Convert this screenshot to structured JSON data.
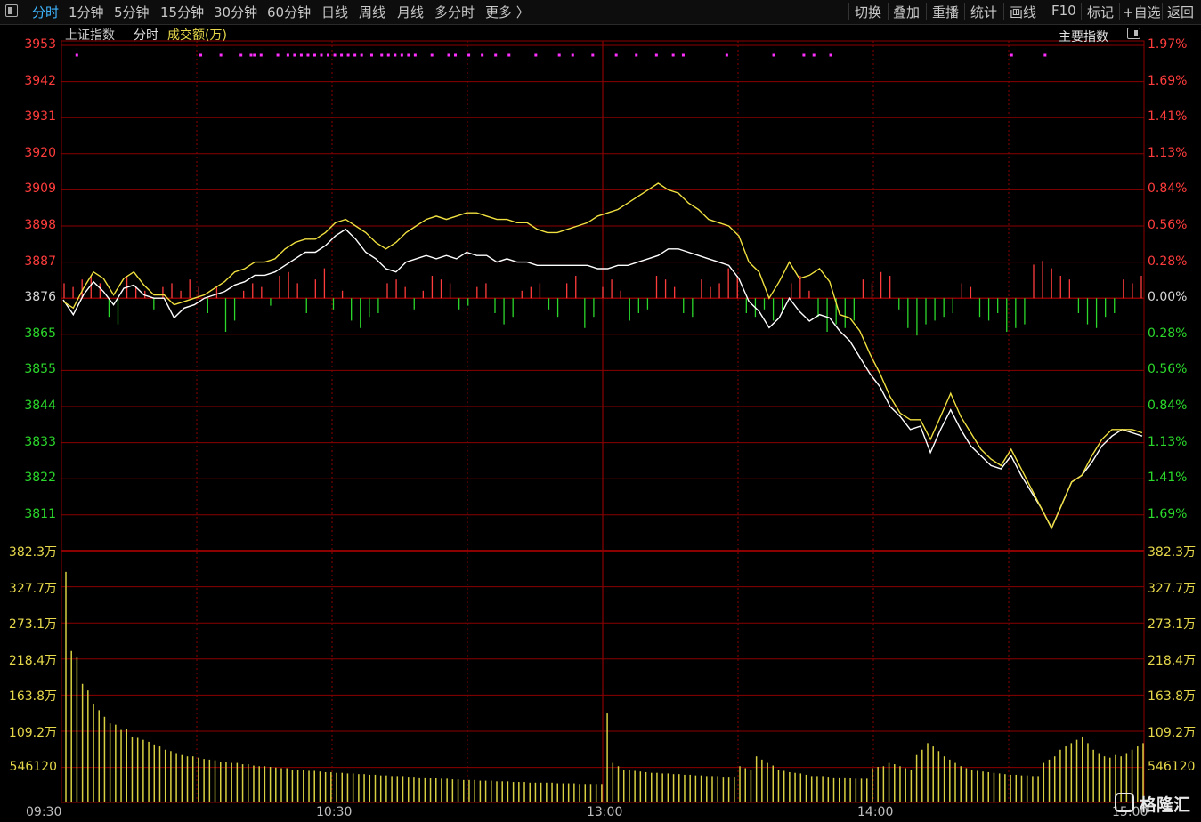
{
  "toolbar": {
    "tabs": [
      "分时",
      "1分钟",
      "5分钟",
      "15分钟",
      "30分钟",
      "60分钟",
      "日线",
      "周线",
      "月线",
      "多分时",
      "更多 〉"
    ],
    "active_tab": "分时",
    "actions": [
      "切换",
      "叠加",
      "重播",
      "统计",
      "画线",
      "F10",
      "标记",
      "+自选",
      "返回"
    ]
  },
  "subheader": {
    "index_name": "上证指数",
    "mode": "分时",
    "volume_label": "成交额(万)",
    "main_index_button": "主要指数"
  },
  "watermark": "格隆汇",
  "colors": {
    "up": "#ff3c3c",
    "down": "#2bd82b",
    "grid": "#8b0000",
    "price_line": "#ffffff",
    "avg_line": "#f0e040",
    "volume": "#d8d040",
    "signal": "#ff30ff"
  },
  "chart_data": {
    "type": "line",
    "price_axis": {
      "left_labels": [
        "3953",
        "3942",
        "3931",
        "3920",
        "3909",
        "3898",
        "3887",
        "3876",
        "3865",
        "3855",
        "3844",
        "3833",
        "3822",
        "3811"
      ],
      "right_labels": [
        "1.97%",
        "1.69%",
        "1.41%",
        "1.13%",
        "0.84%",
        "0.56%",
        "0.28%",
        "0.00%",
        "0.28%",
        "0.56%",
        "0.84%",
        "1.13%",
        "1.41%",
        "1.69%"
      ],
      "prev_close": 3876,
      "ylim": [
        3800.5,
        3953
      ]
    },
    "volume_axis": {
      "labels": [
        "382.3万",
        "327.7万",
        "273.1万",
        "218.4万",
        "163.8万",
        "109.2万",
        "546120"
      ],
      "ylim": [
        0,
        382.3
      ]
    },
    "time_labels": [
      "09:30",
      "10:30",
      "13:00",
      "14:00",
      "15:00"
    ],
    "minutes_total": 240,
    "series": [
      {
        "points": [
          [
            0,
            3875.5
          ],
          [
            3,
            3871
          ],
          [
            6,
            3877
          ],
          [
            9,
            3881
          ],
          [
            12,
            3878
          ],
          [
            15,
            3874
          ],
          [
            18,
            3879
          ],
          [
            21,
            3880
          ],
          [
            24,
            3877
          ],
          [
            27,
            3876
          ],
          [
            30,
            3876
          ],
          [
            33,
            3870
          ],
          [
            36,
            3873
          ],
          [
            39,
            3874
          ],
          [
            42,
            3876
          ],
          [
            45,
            3877
          ],
          [
            48,
            3878
          ],
          [
            51,
            3880
          ],
          [
            54,
            3881
          ],
          [
            57,
            3883
          ],
          [
            60,
            3883
          ],
          [
            63,
            3884
          ],
          [
            66,
            3886
          ],
          [
            69,
            3888
          ],
          [
            72,
            3890
          ],
          [
            75,
            3890
          ],
          [
            78,
            3892
          ],
          [
            81,
            3895
          ],
          [
            84,
            3897
          ],
          [
            87,
            3894
          ],
          [
            90,
            3890
          ],
          [
            93,
            3888
          ],
          [
            96,
            3885
          ],
          [
            99,
            3884
          ],
          [
            102,
            3887
          ],
          [
            105,
            3888
          ],
          [
            108,
            3889
          ],
          [
            111,
            3888
          ],
          [
            114,
            3889
          ],
          [
            117,
            3888
          ],
          [
            120,
            3890
          ],
          [
            123,
            3889
          ],
          [
            126,
            3889
          ],
          [
            129,
            3887
          ],
          [
            132,
            3888
          ],
          [
            135,
            3887
          ],
          [
            138,
            3887
          ],
          [
            141,
            3886
          ],
          [
            144,
            3886
          ],
          [
            147,
            3886
          ],
          [
            150,
            3886
          ],
          [
            153,
            3886
          ],
          [
            156,
            3886
          ],
          [
            159,
            3885
          ],
          [
            162,
            3885
          ],
          [
            165,
            3886
          ],
          [
            168,
            3886
          ],
          [
            171,
            3887
          ],
          [
            174,
            3888
          ],
          [
            177,
            3889
          ],
          [
            180,
            3891
          ],
          [
            183,
            3891
          ],
          [
            186,
            3890
          ],
          [
            189,
            3889
          ],
          [
            192,
            3888
          ],
          [
            195,
            3887
          ],
          [
            198,
            3886
          ],
          [
            201,
            3882
          ],
          [
            204,
            3875
          ],
          [
            207,
            3872
          ],
          [
            210,
            3867
          ],
          [
            213,
            3870
          ],
          [
            216,
            3876
          ],
          [
            219,
            3872
          ],
          [
            222,
            3869
          ],
          [
            225,
            3871
          ],
          [
            228,
            3870
          ],
          [
            231,
            3866
          ],
          [
            234,
            3863
          ],
          [
            237,
            3858
          ],
          [
            240,
            3853
          ],
          [
            243,
            3849
          ],
          [
            246,
            3843
          ],
          [
            249,
            3840
          ],
          [
            252,
            3836
          ],
          [
            255,
            3837
          ],
          [
            258,
            3829
          ],
          [
            261,
            3836
          ],
          [
            264,
            3842
          ],
          [
            267,
            3836
          ],
          [
            270,
            3831
          ],
          [
            273,
            3828
          ],
          [
            276,
            3825
          ],
          [
            279,
            3824
          ],
          [
            282,
            3828
          ],
          [
            285,
            3822
          ],
          [
            288,
            3817
          ],
          [
            291,
            3812
          ],
          [
            294,
            3806
          ],
          [
            297,
            3813
          ],
          [
            300,
            3820
          ],
          [
            303,
            3822
          ],
          [
            306,
            3826
          ],
          [
            309,
            3831
          ],
          [
            312,
            3834
          ],
          [
            315,
            3836
          ],
          [
            318,
            3835
          ],
          [
            321,
            3834
          ]
        ]
      },
      {
        "points": [
          [
            0,
            3875
          ],
          [
            3,
            3873
          ],
          [
            6,
            3879
          ],
          [
            9,
            3884
          ],
          [
            12,
            3882
          ],
          [
            15,
            3877
          ],
          [
            18,
            3882
          ],
          [
            21,
            3884
          ],
          [
            24,
            3880
          ],
          [
            27,
            3877
          ],
          [
            30,
            3877
          ],
          [
            33,
            3874
          ],
          [
            36,
            3875
          ],
          [
            39,
            3876
          ],
          [
            42,
            3877
          ],
          [
            45,
            3879
          ],
          [
            48,
            3881
          ],
          [
            51,
            3884
          ],
          [
            54,
            3885
          ],
          [
            57,
            3887
          ],
          [
            60,
            3887
          ],
          [
            63,
            3888
          ],
          [
            66,
            3891
          ],
          [
            69,
            3893
          ],
          [
            72,
            3894
          ],
          [
            75,
            3894
          ],
          [
            78,
            3896
          ],
          [
            81,
            3899
          ],
          [
            84,
            3900
          ],
          [
            87,
            3898
          ],
          [
            90,
            3896
          ],
          [
            93,
            3893
          ],
          [
            96,
            3891
          ],
          [
            99,
            3893
          ],
          [
            102,
            3896
          ],
          [
            105,
            3898
          ],
          [
            108,
            3900
          ],
          [
            111,
            3901
          ],
          [
            114,
            3900
          ],
          [
            117,
            3901
          ],
          [
            120,
            3902
          ],
          [
            123,
            3902
          ],
          [
            126,
            3901
          ],
          [
            129,
            3900
          ],
          [
            132,
            3900
          ],
          [
            135,
            3899
          ],
          [
            138,
            3899
          ],
          [
            141,
            3897
          ],
          [
            144,
            3896
          ],
          [
            147,
            3896
          ],
          [
            150,
            3897
          ],
          [
            153,
            3898
          ],
          [
            156,
            3899
          ],
          [
            159,
            3901
          ],
          [
            162,
            3902
          ],
          [
            165,
            3903
          ],
          [
            168,
            3905
          ],
          [
            171,
            3907
          ],
          [
            174,
            3909
          ],
          [
            177,
            3911
          ],
          [
            180,
            3909
          ],
          [
            183,
            3908
          ],
          [
            186,
            3905
          ],
          [
            189,
            3903
          ],
          [
            192,
            3900
          ],
          [
            195,
            3899
          ],
          [
            198,
            3898
          ],
          [
            201,
            3895
          ],
          [
            204,
            3887
          ],
          [
            207,
            3884
          ],
          [
            210,
            3876
          ],
          [
            213,
            3881
          ],
          [
            216,
            3887
          ],
          [
            219,
            3882
          ],
          [
            222,
            3883
          ],
          [
            225,
            3885
          ],
          [
            228,
            3881
          ],
          [
            231,
            3871
          ],
          [
            234,
            3870
          ],
          [
            237,
            3866
          ],
          [
            240,
            3859
          ],
          [
            243,
            3853
          ],
          [
            246,
            3846
          ],
          [
            249,
            3841
          ],
          [
            252,
            3839
          ],
          [
            255,
            3839
          ],
          [
            258,
            3833
          ],
          [
            261,
            3840
          ],
          [
            264,
            3847
          ],
          [
            267,
            3840
          ],
          [
            270,
            3835
          ],
          [
            273,
            3830
          ],
          [
            276,
            3827
          ],
          [
            279,
            3825
          ],
          [
            282,
            3830
          ],
          [
            285,
            3824
          ],
          [
            288,
            3818
          ],
          [
            291,
            3812
          ],
          [
            294,
            3806
          ],
          [
            297,
            3813
          ],
          [
            300,
            3820
          ],
          [
            303,
            3822
          ],
          [
            306,
            3828
          ],
          [
            309,
            3833
          ],
          [
            312,
            3836
          ],
          [
            315,
            3836
          ],
          [
            318,
            3836
          ],
          [
            321,
            3835
          ]
        ]
      }
    ],
    "change_bars": [
      4,
      3,
      5,
      6,
      4,
      -5,
      -7,
      6,
      3,
      2,
      -3,
      3,
      4,
      2,
      5,
      3,
      -4,
      3,
      -9,
      -6,
      2,
      4,
      3,
      -2,
      6,
      7,
      4,
      -4,
      5,
      8,
      -3,
      2,
      -6,
      -8,
      -5,
      -4,
      4,
      5,
      3,
      -3,
      2,
      6,
      5,
      4,
      -3,
      -2,
      3,
      4,
      -4,
      -7,
      -5,
      2,
      3,
      4,
      -3,
      -5,
      4,
      6,
      -8,
      -5,
      3,
      5,
      2,
      -6,
      -4,
      -3,
      6,
      5,
      3,
      -4,
      -5,
      5,
      3,
      4,
      8,
      6,
      -4,
      -5,
      -3,
      -6,
      -4,
      4,
      6,
      2,
      -5,
      -9,
      -7,
      -8,
      -6,
      5,
      4,
      7,
      6,
      -3,
      -8,
      -10,
      -7,
      -6,
      -5,
      -4,
      4,
      3,
      -5,
      -6,
      -4,
      -9,
      -8,
      -7,
      9,
      10,
      8,
      6,
      5,
      -4,
      -7,
      -8,
      -5,
      -4,
      5,
      4,
      6
    ],
    "volume": [
      350,
      230,
      220,
      180,
      170,
      150,
      140,
      130,
      120,
      118,
      110,
      112,
      100,
      98,
      95,
      92,
      88,
      85,
      80,
      78,
      75,
      72,
      70,
      70,
      68,
      66,
      65,
      64,
      62,
      62,
      60,
      60,
      58,
      58,
      56,
      55,
      55,
      54,
      53,
      52,
      52,
      50,
      50,
      49,
      48,
      48,
      47,
      46,
      46,
      45,
      45,
      44,
      44,
      43,
      43,
      42,
      42,
      41,
      41,
      40,
      40,
      40,
      39,
      39,
      38,
      38,
      37,
      37,
      36,
      36,
      35,
      35,
      34,
      34,
      34,
      33,
      33,
      33,
      32,
      32,
      32,
      31,
      31,
      31,
      30,
      30,
      30,
      30,
      30,
      29,
      29,
      29,
      29,
      28,
      28,
      28,
      28,
      28,
      135,
      60,
      55,
      50,
      50,
      48,
      47,
      46,
      45,
      45,
      44,
      44,
      43,
      43,
      42,
      42,
      41,
      41,
      40,
      40,
      40,
      39,
      39,
      39,
      55,
      52,
      50,
      70,
      65,
      60,
      56,
      50,
      48,
      46,
      45,
      44,
      42,
      40,
      40,
      40,
      39,
      38,
      38,
      38,
      37,
      36,
      36,
      36,
      52,
      54,
      55,
      60,
      58,
      55,
      52,
      50,
      72,
      80,
      90,
      85,
      78,
      70,
      65,
      60,
      55,
      52,
      50,
      48,
      47,
      46,
      45,
      44,
      43,
      42,
      42,
      41,
      41,
      40,
      40,
      60,
      65,
      70,
      80,
      85,
      90,
      95,
      100,
      90,
      80,
      75,
      70,
      68,
      72,
      70,
      75,
      80,
      85,
      90
    ],
    "signals": [
      3,
      40,
      46,
      52,
      55,
      56,
      58,
      63,
      66,
      68,
      70,
      72,
      74,
      76,
      78,
      80,
      82,
      84,
      86,
      88,
      91,
      94,
      96,
      98,
      100,
      102,
      104,
      109,
      114,
      116,
      120,
      124,
      128,
      132,
      140,
      147,
      151,
      157,
      164,
      170,
      176,
      181,
      184,
      197,
      211,
      220,
      223,
      228,
      282,
      292
    ]
  }
}
